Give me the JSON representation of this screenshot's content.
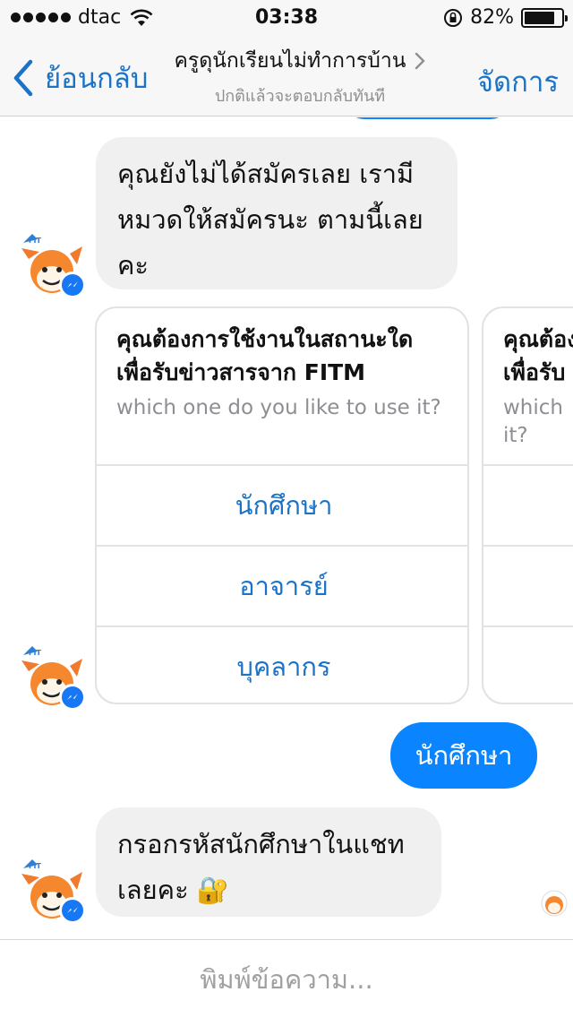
{
  "status": {
    "carrier": "dtac",
    "time": "03:38",
    "battery": "82%",
    "battery_level": 0.82
  },
  "nav": {
    "back_label": "ย้อนกลับ",
    "title": "ครูดุนักเรียนไม่ทำการบ้าน",
    "subtitle": "ปกติแล้วจะตอบกลับทันที",
    "manage_label": "จัดการ"
  },
  "messages": {
    "msg1_lines": [
      "คุณยังไม่ได้สมัครเลย เรามี",
      "หมวดให้สมัครนะ ตามนี้เลย",
      "คะ"
    ],
    "card1": {
      "title_line1": "คุณต้องการใช้งานในสถานะใด",
      "title_line2": "เพื่อรับข่าวสารจาก FITM",
      "sub": "which one do you like to use it?",
      "options": [
        "นักศึกษา",
        "อาจารย์",
        "บุคลากร"
      ]
    },
    "card2": {
      "title_line1": "คุณต้อง",
      "title_line2": "เพื่อรับ",
      "sub_line1": "which",
      "sub_line2": "it?"
    },
    "reply": "นักศึกษา",
    "msg2_line1": "กรอกรหัสนักศึกษาในแชท",
    "msg2_line2": "เลยคะ",
    "msg2_emoji": "🔐"
  },
  "avatar": {
    "badge_text": "FIT"
  },
  "composer": {
    "placeholder": "พิมพ์ข้อความ..."
  },
  "colors": {
    "accent": "#1a73c8",
    "outgoing_bubble": "#0a84ff",
    "incoming_bubble": "#f0f0f0"
  }
}
